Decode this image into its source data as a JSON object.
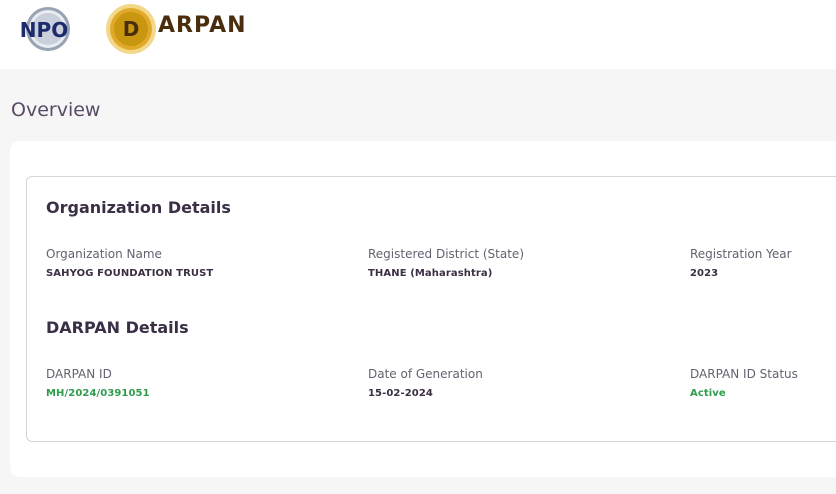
{
  "header": {
    "ngo_logo_text": "NPO",
    "darpan_logo_letter": "D",
    "darpan_wordmark": "ARPAN"
  },
  "page": {
    "title": "Overview"
  },
  "organization": {
    "section_title": "Organization Details",
    "fields": [
      {
        "label": "Organization Name",
        "value": "SAHYOG FOUNDATION TRUST"
      },
      {
        "label": "Registered District (State)",
        "value": "THANE (Maharashtra)"
      },
      {
        "label": "Registration Year",
        "value": "2023"
      }
    ]
  },
  "darpan": {
    "section_title": "DARPAN Details",
    "fields": [
      {
        "label": "DARPAN ID",
        "value": "MH/2024/0391051"
      },
      {
        "label": "Date of Generation",
        "value": "15-02-2024"
      },
      {
        "label": "DARPAN ID Status",
        "value": "Active"
      }
    ]
  },
  "colors": {
    "accent_green": "#2e9d4e",
    "text_dark": "#3a2f45",
    "logo_gold": "#c9960f"
  }
}
